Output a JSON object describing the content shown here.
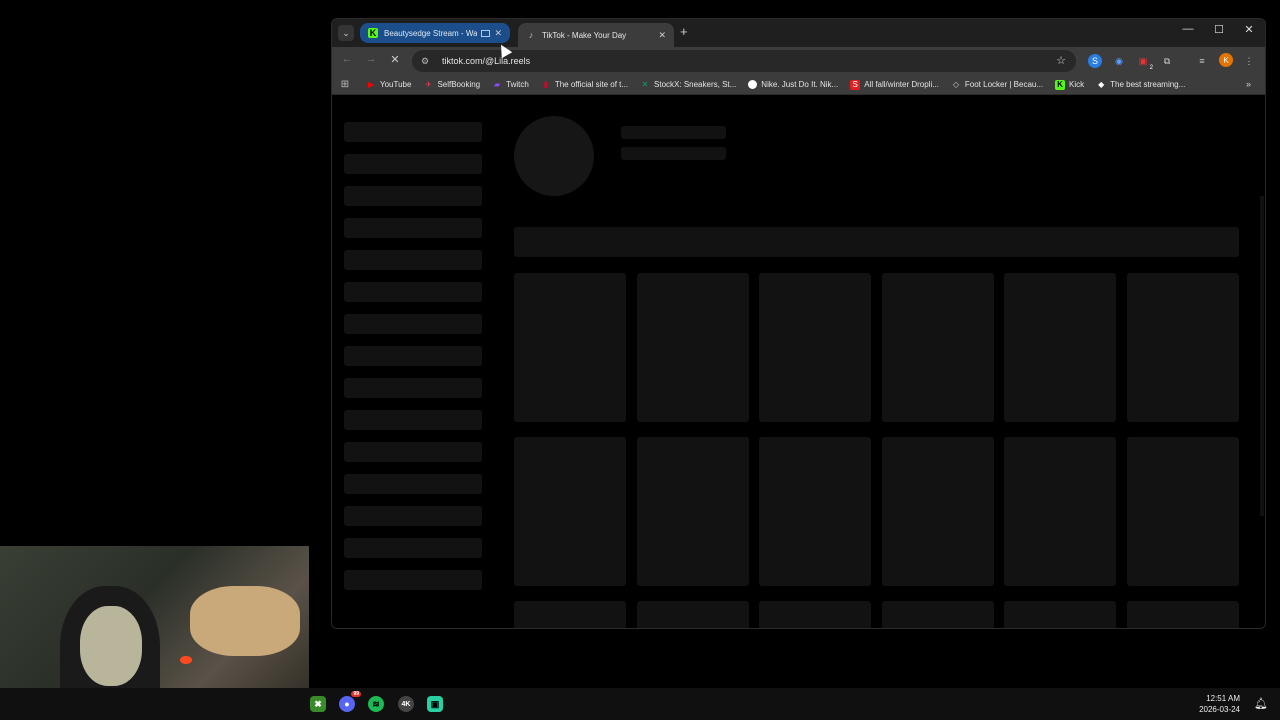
{
  "browser": {
    "tabs": [
      {
        "title": "Beautysedge Stream - Wat",
        "favicon": "kick-icon",
        "active": false,
        "playing_media": true
      },
      {
        "title": "TikTok - Make Your Day",
        "favicon": "tiktok-icon",
        "active": true
      }
    ],
    "url": "tiktok.com/@Lila.reels",
    "bookmarks": [
      {
        "label": "YouTube",
        "icon": "youtube-icon",
        "color": "#ff0000"
      },
      {
        "label": "SelfBooking",
        "icon": "selfbooking-icon",
        "color": "#e04050"
      },
      {
        "label": "Twitch",
        "icon": "twitch-icon",
        "color": "#9146ff"
      },
      {
        "label": "The official site of t...",
        "icon": "nba-icon",
        "color": "#c9082a"
      },
      {
        "label": "StockX: Sneakers, St...",
        "icon": "stockx-icon",
        "color": "#08a05c"
      },
      {
        "label": "Nike. Just Do It. Nik...",
        "icon": "nike-icon",
        "color": "#ffffff"
      },
      {
        "label": "All fall/winter Dropli...",
        "icon": "supreme-icon",
        "color": "#e02020"
      },
      {
        "label": "Foot Locker | Becau...",
        "icon": "footlocker-icon",
        "color": "#cccccc"
      },
      {
        "label": "Kick",
        "icon": "kick-icon",
        "color": "#53fc18"
      },
      {
        "label": "The best streaming...",
        "icon": "diamond-icon",
        "color": "#ffffff"
      }
    ],
    "extensions_badge": "2",
    "profile_initial": "K"
  },
  "taskbar": {
    "apps": [
      {
        "name": "minecraft-icon",
        "color": "#3a8c2a",
        "glyph": "✖"
      },
      {
        "name": "discord-icon",
        "color": "#5865f2",
        "glyph": "●",
        "badge": "99"
      },
      {
        "name": "spotify-icon",
        "color": "#1db954",
        "glyph": "≋"
      },
      {
        "name": "4k-video-icon",
        "color": "#444444",
        "glyph": "4K"
      },
      {
        "name": "streaming-app-icon",
        "color": "#2ad1a0",
        "glyph": "▣"
      }
    ],
    "time": "12:51 AM",
    "date": "2026-03-24"
  }
}
